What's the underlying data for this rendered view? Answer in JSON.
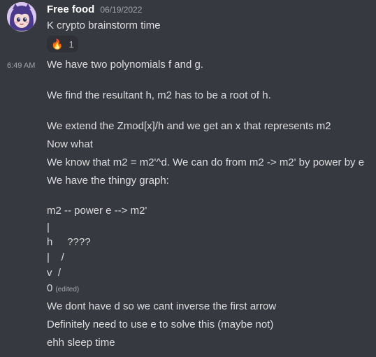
{
  "author": {
    "name": "Free food",
    "date": "06/19/2022",
    "avatar_icon": "anime-girl-avatar"
  },
  "reaction": {
    "emoji": "fire-emoji",
    "count": "1"
  },
  "hover_time": "6:49 AM",
  "edited_label": "(edited)",
  "messages": [
    "K crypto brainstorm time",
    "We have two polynomials f and g.",
    "We find the resultant h, m2 has to be a root of h.",
    "We extend the Zmod[x]/h and we get an x that represents m2",
    "Now what",
    "We know that m2 = m2'^d. We can do from m2 -> m2' by power by e",
    "We have the thingy graph:",
    "m2 -- power e --> m2'",
    "|",
    "h     ????",
    "|    /",
    "v  /",
    "0",
    "We dont have d so we cant inverse the first arrow",
    "Definitely need to use e to solve this (maybe not)",
    "ehh sleep time"
  ],
  "colors": {
    "background": "#36393f",
    "username": "#ffffff",
    "text": "#dcddde",
    "muted": "#a3a6aa",
    "reaction_bg": "#2f3136"
  }
}
